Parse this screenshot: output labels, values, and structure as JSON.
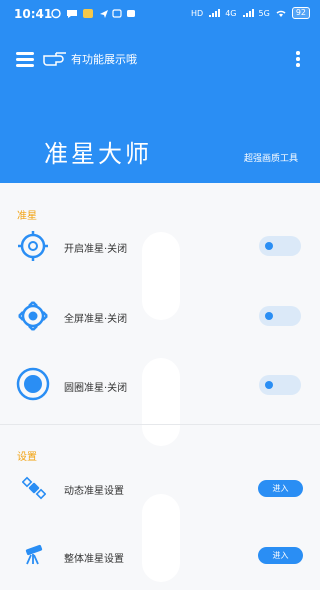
{
  "status_bar": {
    "time": "10:41",
    "network_labels": [
      "HD",
      "4G",
      "5G"
    ],
    "battery": "92"
  },
  "header": {
    "promo_text": "有功能展示哦",
    "app_title": "准星大师",
    "app_subtitle": "超强画质工具"
  },
  "crosshair_section": {
    "title": "准星",
    "items": [
      {
        "label": "开启准星·关闭",
        "icon": "crosshair-ring-icon",
        "enabled": true
      },
      {
        "label": "全屏准星·关闭",
        "icon": "crosshair-diamond-icon",
        "enabled": true
      },
      {
        "label": "圆圈准星·关闭",
        "icon": "crosshair-dot-icon",
        "enabled": true
      }
    ]
  },
  "settings_section": {
    "title": "设置",
    "items": [
      {
        "label": "动态准星设置",
        "icon": "satellite-icon",
        "button": "进入"
      },
      {
        "label": "整体准星设置",
        "icon": "telescope-icon",
        "button": "进入"
      }
    ]
  },
  "colors": {
    "primary": "#2a8ef4",
    "section_title": "#f2a20f",
    "toggle_track": "#dbe9f8",
    "background": "#f7f8fa"
  }
}
